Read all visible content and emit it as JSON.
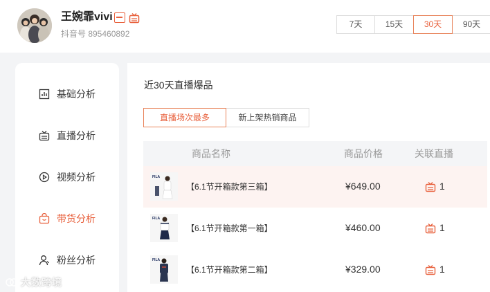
{
  "profile": {
    "name": "王婉霏vivi",
    "douyin_id": "抖音号 895460892"
  },
  "date_ranges": [
    {
      "label": "7天"
    },
    {
      "label": "15天"
    },
    {
      "label": "30天",
      "active": true
    },
    {
      "label": "90天"
    }
  ],
  "sidebar": {
    "items": [
      {
        "label": "基础分析",
        "icon": "bar-chart-icon"
      },
      {
        "label": "直播分析",
        "icon": "live-tv-icon"
      },
      {
        "label": "视频分析",
        "icon": "play-circle-icon"
      },
      {
        "label": "带货分析",
        "icon": "shopping-bag-icon",
        "active": true
      },
      {
        "label": "粉丝分析",
        "icon": "user-icon"
      }
    ]
  },
  "main": {
    "title": "近30天直播爆品",
    "tabs": [
      {
        "label": "直播场次最多",
        "active": true
      },
      {
        "label": "新上架热销商品"
      }
    ],
    "table": {
      "headers": [
        "商品名称",
        "商品价格",
        "关联直播"
      ],
      "rows": [
        {
          "name": "【6.1节开箱款第三箱】",
          "price": "¥649.00",
          "live_count": "1"
        },
        {
          "name": "【6.1节开箱款第一箱】",
          "price": "¥460.00",
          "live_count": "1"
        },
        {
          "name": "【6.1节开箱款第二箱】",
          "price": "¥329.00",
          "live_count": "1"
        }
      ]
    }
  },
  "watermark": "大数跨境",
  "colors": {
    "accent": "#e8603c",
    "highlight_row": "#fdf3f1",
    "table_header_bg": "#f4f5f7",
    "page_bg": "#f3f4f6"
  }
}
